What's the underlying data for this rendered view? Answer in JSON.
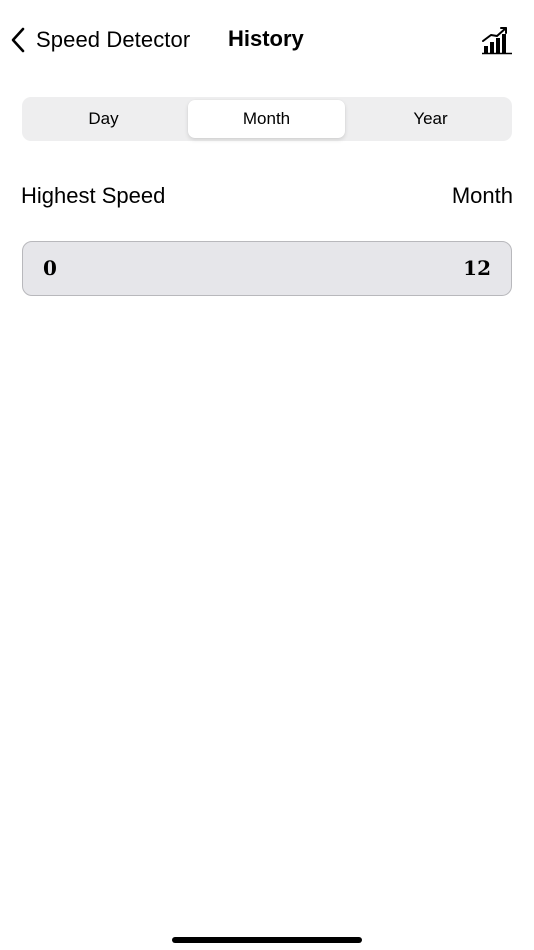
{
  "nav": {
    "back_label": "Speed Detector",
    "title": "History",
    "back_icon": "chevron-left-icon",
    "action_icon": "bar-chart-trend-icon"
  },
  "segments": {
    "items": [
      {
        "label": "Day"
      },
      {
        "label": "Month"
      },
      {
        "label": "Year"
      }
    ],
    "selected": "Month"
  },
  "section": {
    "title": "Highest Speed",
    "period": "Month"
  },
  "range": {
    "min": "0",
    "max": "12"
  },
  "colors": {
    "segment_bg": "#eeeeef",
    "segment_selected_bg": "#ffffff",
    "range_bg": "#e6e6ea",
    "range_border": "#b8b8bc",
    "text": "#000000"
  }
}
